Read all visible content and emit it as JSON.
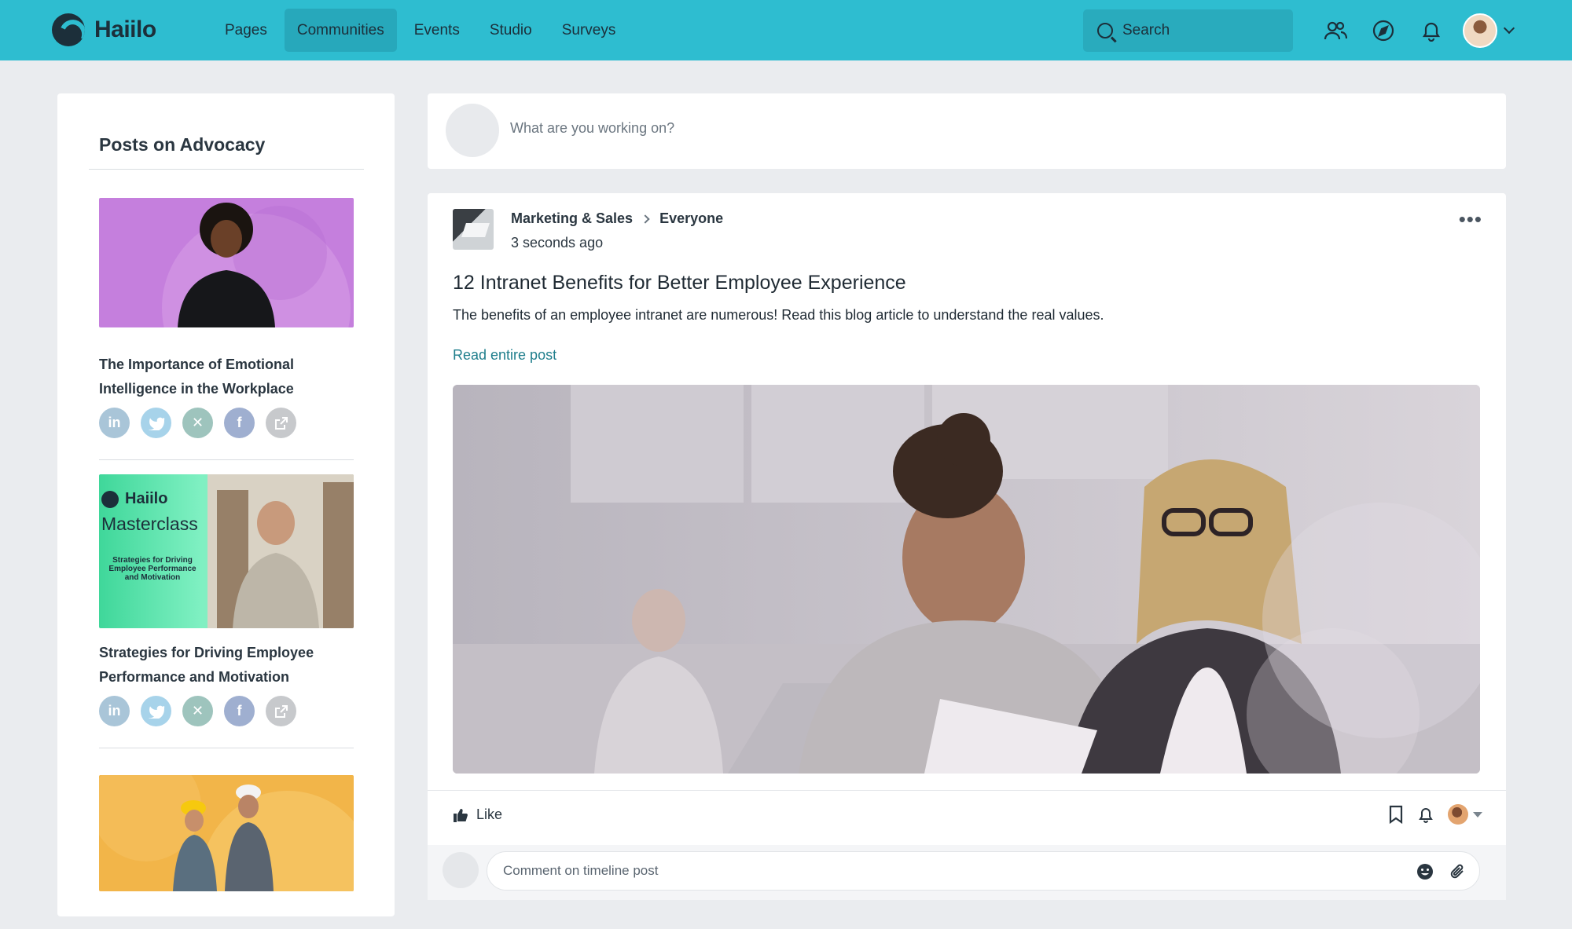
{
  "app": {
    "brand": "Haiilo",
    "accent": "#2ebdd0",
    "link_color": "#1f7e8c"
  },
  "nav": {
    "items": [
      {
        "label": "Pages",
        "active": false
      },
      {
        "label": "Communities",
        "active": true
      },
      {
        "label": "Events",
        "active": false
      },
      {
        "label": "Studio",
        "active": false
      },
      {
        "label": "Surveys",
        "active": false
      }
    ],
    "search_label": "Search"
  },
  "sidebar": {
    "title": "Posts on Advocacy",
    "cards": [
      {
        "title": "The Importance of Emotional Intelligence in the Workplace"
      },
      {
        "title": "Strategies for Driving Employee Performance and Motivation",
        "image_brand": "Haiilo",
        "image_heading": "Masterclass",
        "image_subtitle": "Strategies for Driving Employee Performance and Motivation"
      },
      {
        "title": ""
      }
    ],
    "share_icons": [
      "linkedin-icon",
      "twitter-icon",
      "xing-icon",
      "facebook-icon",
      "external-share-icon"
    ]
  },
  "composer": {
    "placeholder": "What are you working on?"
  },
  "post": {
    "community": "Marketing & Sales",
    "audience": "Everyone",
    "time": "3 seconds ago",
    "title": "12 Intranet Benefits for Better Employee Experience",
    "description": "The benefits of an employee intranet are numerous! Read this blog article to understand the real values.",
    "read_more": "Read entire post",
    "like_label": "Like",
    "comment_placeholder": "Comment on timeline post"
  }
}
